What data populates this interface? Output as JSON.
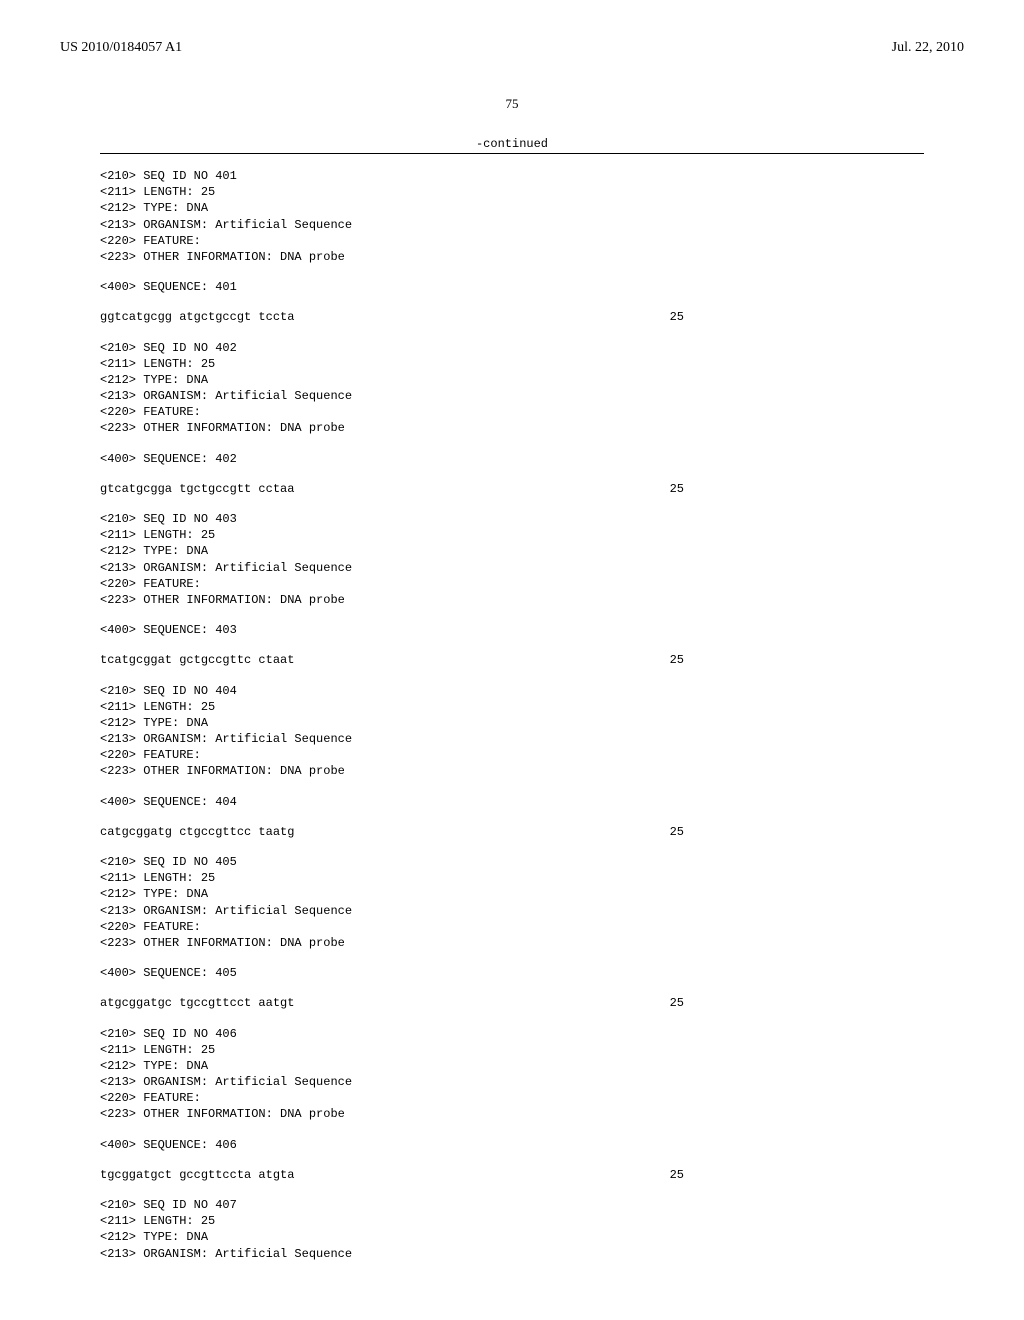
{
  "header": {
    "patent_number": "US 2010/0184057 A1",
    "date": "Jul. 22, 2010"
  },
  "page_number": "75",
  "continued_label": "-continued",
  "sequences": [
    {
      "id_line": "<210> SEQ ID NO 401",
      "length_line": "<211> LENGTH: 25",
      "type_line": "<212> TYPE: DNA",
      "organism_line": "<213> ORGANISM: Artificial Sequence",
      "feature_line": "<220> FEATURE:",
      "other_info_line": "<223> OTHER INFORMATION: DNA probe",
      "sequence_label": "<400> SEQUENCE: 401",
      "sequence": "ggtcatgcgg atgctgccgt tccta",
      "position": "25"
    },
    {
      "id_line": "<210> SEQ ID NO 402",
      "length_line": "<211> LENGTH: 25",
      "type_line": "<212> TYPE: DNA",
      "organism_line": "<213> ORGANISM: Artificial Sequence",
      "feature_line": "<220> FEATURE:",
      "other_info_line": "<223> OTHER INFORMATION: DNA probe",
      "sequence_label": "<400> SEQUENCE: 402",
      "sequence": "gtcatgcgga tgctgccgtt cctaa",
      "position": "25"
    },
    {
      "id_line": "<210> SEQ ID NO 403",
      "length_line": "<211> LENGTH: 25",
      "type_line": "<212> TYPE: DNA",
      "organism_line": "<213> ORGANISM: Artificial Sequence",
      "feature_line": "<220> FEATURE:",
      "other_info_line": "<223> OTHER INFORMATION: DNA probe",
      "sequence_label": "<400> SEQUENCE: 403",
      "sequence": "tcatgcggat gctgccgttc ctaat",
      "position": "25"
    },
    {
      "id_line": "<210> SEQ ID NO 404",
      "length_line": "<211> LENGTH: 25",
      "type_line": "<212> TYPE: DNA",
      "organism_line": "<213> ORGANISM: Artificial Sequence",
      "feature_line": "<220> FEATURE:",
      "other_info_line": "<223> OTHER INFORMATION: DNA probe",
      "sequence_label": "<400> SEQUENCE: 404",
      "sequence": "catgcggatg ctgccgttcc taatg",
      "position": "25"
    },
    {
      "id_line": "<210> SEQ ID NO 405",
      "length_line": "<211> LENGTH: 25",
      "type_line": "<212> TYPE: DNA",
      "organism_line": "<213> ORGANISM: Artificial Sequence",
      "feature_line": "<220> FEATURE:",
      "other_info_line": "<223> OTHER INFORMATION: DNA probe",
      "sequence_label": "<400> SEQUENCE: 405",
      "sequence": "atgcggatgc tgccgttcct aatgt",
      "position": "25"
    },
    {
      "id_line": "<210> SEQ ID NO 406",
      "length_line": "<211> LENGTH: 25",
      "type_line": "<212> TYPE: DNA",
      "organism_line": "<213> ORGANISM: Artificial Sequence",
      "feature_line": "<220> FEATURE:",
      "other_info_line": "<223> OTHER INFORMATION: DNA probe",
      "sequence_label": "<400> SEQUENCE: 406",
      "sequence": "tgcggatgct gccgttccta atgta",
      "position": "25"
    },
    {
      "id_line": "<210> SEQ ID NO 407",
      "length_line": "<211> LENGTH: 25",
      "type_line": "<212> TYPE: DNA",
      "organism_line": "<213> ORGANISM: Artificial Sequence",
      "feature_line": "",
      "other_info_line": "",
      "sequence_label": "",
      "sequence": "",
      "position": ""
    }
  ]
}
